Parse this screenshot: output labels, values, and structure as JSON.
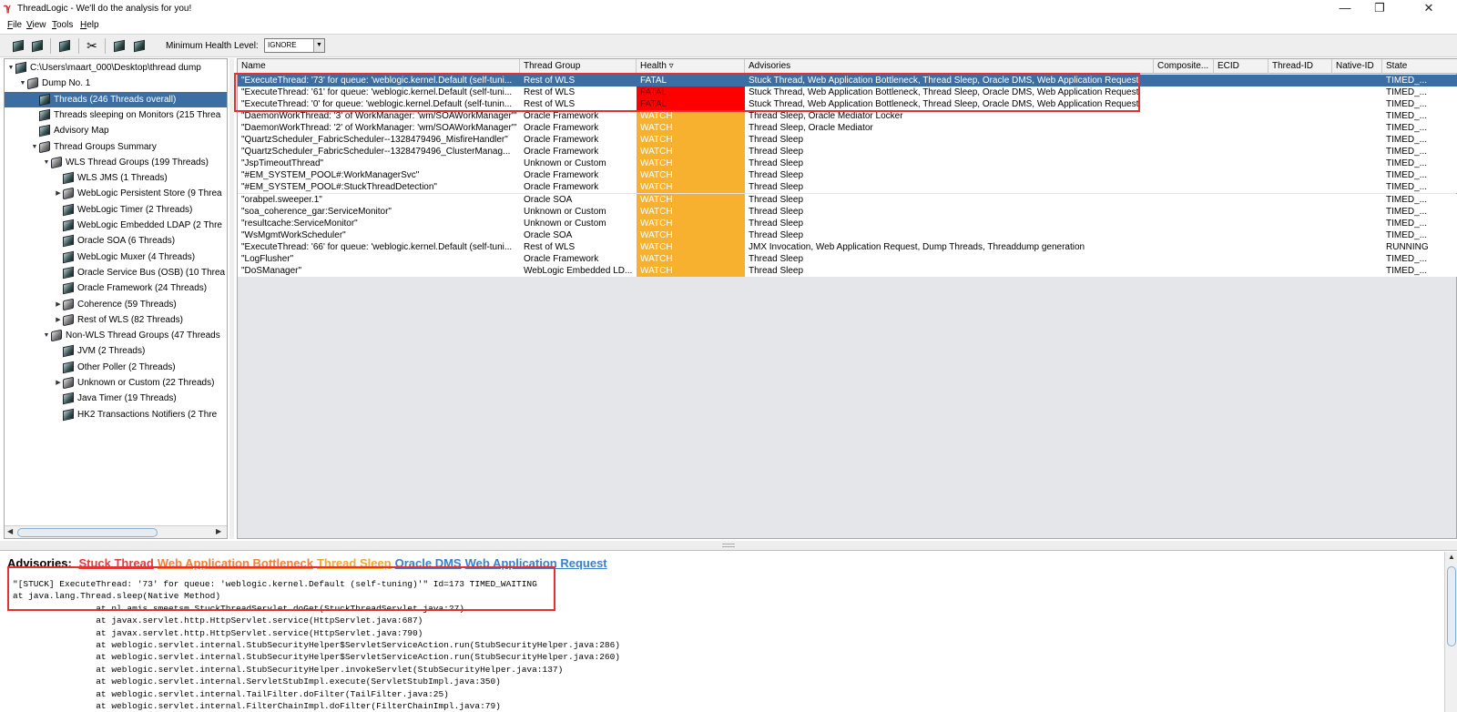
{
  "window": {
    "title": "ThreadLogic - We'll do the analysis for you!",
    "app_icon": "threadlogic-logo-icon",
    "minimize": "—",
    "restore": "❐",
    "close": "✕"
  },
  "menu": [
    "File",
    "View",
    "Tools",
    "Help"
  ],
  "toolbar": {
    "icons": [
      "open-dump-icon",
      "refresh-icon",
      "filter-icon",
      "tools-icon",
      "expand-icon",
      "collapse-icon"
    ],
    "health_label": "Minimum Health Level:",
    "health_value": "IGNORE"
  },
  "tree": [
    {
      "label": "C:\\Users\\maart_000\\Desktop\\thread dump",
      "indent": 0,
      "toggle": "▼",
      "icon": "cube"
    },
    {
      "label": "Dump No. 1",
      "indent": 1,
      "toggle": "▼",
      "icon": "folder"
    },
    {
      "label": "Threads (246 Threads overall)",
      "indent": 2,
      "toggle": "",
      "icon": "cube",
      "selected": true
    },
    {
      "label": "Threads sleeping on Monitors (215 Threa",
      "indent": 2,
      "toggle": "",
      "icon": "cube"
    },
    {
      "label": "Advisory Map",
      "indent": 2,
      "toggle": "",
      "icon": "cube"
    },
    {
      "label": "Thread Groups Summary",
      "indent": 2,
      "toggle": "▼",
      "icon": "folder"
    },
    {
      "label": "WLS Thread Groups (199 Threads)",
      "indent": 3,
      "toggle": "▼",
      "icon": "folder"
    },
    {
      "label": "WLS JMS (1 Threads)",
      "indent": 4,
      "toggle": "",
      "icon": "cube"
    },
    {
      "label": "WebLogic Persistent Store (9 Threa",
      "indent": 4,
      "toggle": "▶",
      "icon": "folder"
    },
    {
      "label": "WebLogic Timer (2 Threads)",
      "indent": 4,
      "toggle": "",
      "icon": "cube"
    },
    {
      "label": "WebLogic Embedded LDAP (2 Thre",
      "indent": 4,
      "toggle": "",
      "icon": "cube"
    },
    {
      "label": "Oracle SOA (6 Threads)",
      "indent": 4,
      "toggle": "",
      "icon": "cube"
    },
    {
      "label": "WebLogic Muxer (4 Threads)",
      "indent": 4,
      "toggle": "",
      "icon": "cube"
    },
    {
      "label": "Oracle Service Bus (OSB) (10 Threa",
      "indent": 4,
      "toggle": "",
      "icon": "cube"
    },
    {
      "label": "Oracle Framework (24 Threads)",
      "indent": 4,
      "toggle": "",
      "icon": "cube"
    },
    {
      "label": "Coherence (59 Threads)",
      "indent": 4,
      "toggle": "▶",
      "icon": "folder"
    },
    {
      "label": "Rest of WLS (82 Threads)",
      "indent": 4,
      "toggle": "▶",
      "icon": "folder"
    },
    {
      "label": "Non-WLS Thread Groups (47 Threads",
      "indent": 3,
      "toggle": "▼",
      "icon": "folder"
    },
    {
      "label": "JVM (2 Threads)",
      "indent": 4,
      "toggle": "",
      "icon": "cube"
    },
    {
      "label": "Other Poller (2 Threads)",
      "indent": 4,
      "toggle": "",
      "icon": "cube"
    },
    {
      "label": "Unknown or Custom (22 Threads)",
      "indent": 4,
      "toggle": "▶",
      "icon": "folder"
    },
    {
      "label": "Java Timer (19 Threads)",
      "indent": 4,
      "toggle": "",
      "icon": "cube"
    },
    {
      "label": "HK2 Transactions Notifiers (2 Thre",
      "indent": 4,
      "toggle": "",
      "icon": "cube"
    }
  ],
  "table": {
    "columns": [
      "Name",
      "Thread Group",
      "Health ▿",
      "Advisories",
      "Composite...",
      "ECID",
      "Thread-ID",
      "Native-ID",
      "State"
    ],
    "rows": [
      {
        "name": "\"ExecuteThread: '73' for queue: 'weblogic.kernel.Default (self-tuni...",
        "group": "Rest of WLS",
        "health": "FATAL",
        "advisories": "Stuck Thread, Web Application Bottleneck, Thread Sleep, Oracle DMS, Web Application Request",
        "state": "TIMED_...",
        "selected": true
      },
      {
        "name": "\"ExecuteThread: '61' for queue: 'weblogic.kernel.Default (self-tuni...",
        "group": "Rest of WLS",
        "health": "FATAL",
        "advisories": "Stuck Thread, Web Application Bottleneck, Thread Sleep, Oracle DMS, Web Application Request",
        "state": "TIMED_..."
      },
      {
        "name": "\"ExecuteThread: '0' for queue: 'weblogic.kernel.Default (self-tunin...",
        "group": "Rest of WLS",
        "health": "FATAL",
        "advisories": "Stuck Thread, Web Application Bottleneck, Thread Sleep, Oracle DMS, Web Application Request",
        "state": "TIMED_..."
      },
      {
        "name": "\"DaemonWorkThread: '3' of WorkManager: 'wm/SOAWorkManager'\"",
        "group": "Oracle Framework",
        "health": "WATCH",
        "advisories": "Thread Sleep, Oracle Mediator Locker",
        "state": "TIMED_..."
      },
      {
        "name": "\"DaemonWorkThread: '2' of WorkManager: 'wm/SOAWorkManager'\"",
        "group": "Oracle Framework",
        "health": "WATCH",
        "advisories": "Thread Sleep, Oracle Mediator",
        "state": "TIMED_..."
      },
      {
        "name": "\"QuartzScheduler_FabricScheduler--1328479496_MisfireHandler\"",
        "group": "Oracle Framework",
        "health": "WATCH",
        "advisories": "Thread Sleep",
        "state": "TIMED_..."
      },
      {
        "name": "\"QuartzScheduler_FabricScheduler--1328479496_ClusterManag...",
        "group": "Oracle Framework",
        "health": "WATCH",
        "advisories": "Thread Sleep",
        "state": "TIMED_..."
      },
      {
        "name": "\"JspTimeoutThread\"",
        "group": "Unknown or Custom",
        "health": "WATCH",
        "advisories": "Thread Sleep",
        "state": "TIMED_..."
      },
      {
        "name": "\"#EM_SYSTEM_POOL#:WorkManagerSvc\"",
        "group": "Oracle Framework",
        "health": "WATCH",
        "advisories": "Thread Sleep",
        "state": "TIMED_..."
      },
      {
        "name": "\"#EM_SYSTEM_POOL#:StuckThreadDetection\"",
        "group": "Oracle Framework",
        "health": "WATCH",
        "advisories": "Thread Sleep",
        "state": "TIMED_..."
      },
      {
        "name": "\"orabpel.sweeper.1\"",
        "group": "Oracle SOA",
        "health": "WATCH",
        "advisories": "Thread Sleep",
        "state": "TIMED_..."
      },
      {
        "name": "\"soa_coherence_gar:ServiceMonitor\"",
        "group": "Unknown or Custom",
        "health": "WATCH",
        "advisories": "Thread Sleep",
        "state": "TIMED_..."
      },
      {
        "name": "\"resultcache:ServiceMonitor\"",
        "group": "Unknown or Custom",
        "health": "WATCH",
        "advisories": "Thread Sleep",
        "state": "TIMED_..."
      },
      {
        "name": "\"WsMgmtWorkScheduler\"",
        "group": "Oracle SOA",
        "health": "WATCH",
        "advisories": "Thread Sleep",
        "state": "TIMED_..."
      },
      {
        "name": "\"ExecuteThread: '66' for queue: 'weblogic.kernel.Default (self-tuni...",
        "group": "Rest of WLS",
        "health": "WATCH",
        "advisories": "JMX Invocation, Web Application Request, Dump Threads, Threaddump generation",
        "state": "RUNNING"
      },
      {
        "name": "\"LogFlusher\"",
        "group": "Oracle Framework",
        "health": "WATCH",
        "advisories": "Thread Sleep",
        "state": "TIMED_..."
      },
      {
        "name": "\"DoSManager\"",
        "group": "WebLogic Embedded LD...",
        "health": "WATCH",
        "advisories": "Thread Sleep",
        "state": "TIMED_..."
      }
    ]
  },
  "detail": {
    "advisories_label": "Advisories:",
    "advisories": [
      {
        "label": "Stuck Thread",
        "color": "#e23c3c"
      },
      {
        "label": "Web Application Bottleneck",
        "color": "#f0803c"
      },
      {
        "label": "Thread Sleep",
        "color": "#f0a830"
      },
      {
        "label": "Oracle DMS",
        "color": "#3a7fc8"
      },
      {
        "label": "Web Application Request",
        "color": "#3a7fc8"
      }
    ],
    "stack_lines": [
      "\"[STUCK] ExecuteThread: '73' for queue: 'weblogic.kernel.Default (self-tuning)'\" Id=173 TIMED_WAITING",
      "at java.lang.Thread.sleep(Native Method)",
      "                at nl.amis.smeetsm.StuckThreadServlet.doGet(StuckThreadServlet.java:27)",
      "                at javax.servlet.http.HttpServlet.service(HttpServlet.java:687)",
      "                at javax.servlet.http.HttpServlet.service(HttpServlet.java:790)",
      "                at weblogic.servlet.internal.StubSecurityHelper$ServletServiceAction.run(StubSecurityHelper.java:286)",
      "                at weblogic.servlet.internal.StubSecurityHelper$ServletServiceAction.run(StubSecurityHelper.java:260)",
      "                at weblogic.servlet.internal.StubSecurityHelper.invokeServlet(StubSecurityHelper.java:137)",
      "                at weblogic.servlet.internal.ServletStubImpl.execute(ServletStubImpl.java:350)",
      "                at weblogic.servlet.internal.TailFilter.doFilter(TailFilter.java:25)",
      "                at weblogic.servlet.internal.FilterChainImpl.doFilter(FilterChainImpl.java:79)"
    ]
  },
  "colors": {
    "selection": "#3b6ea5",
    "fatal": "#ff0000",
    "watch": "#f7b12f",
    "highlight": "#e53030"
  }
}
